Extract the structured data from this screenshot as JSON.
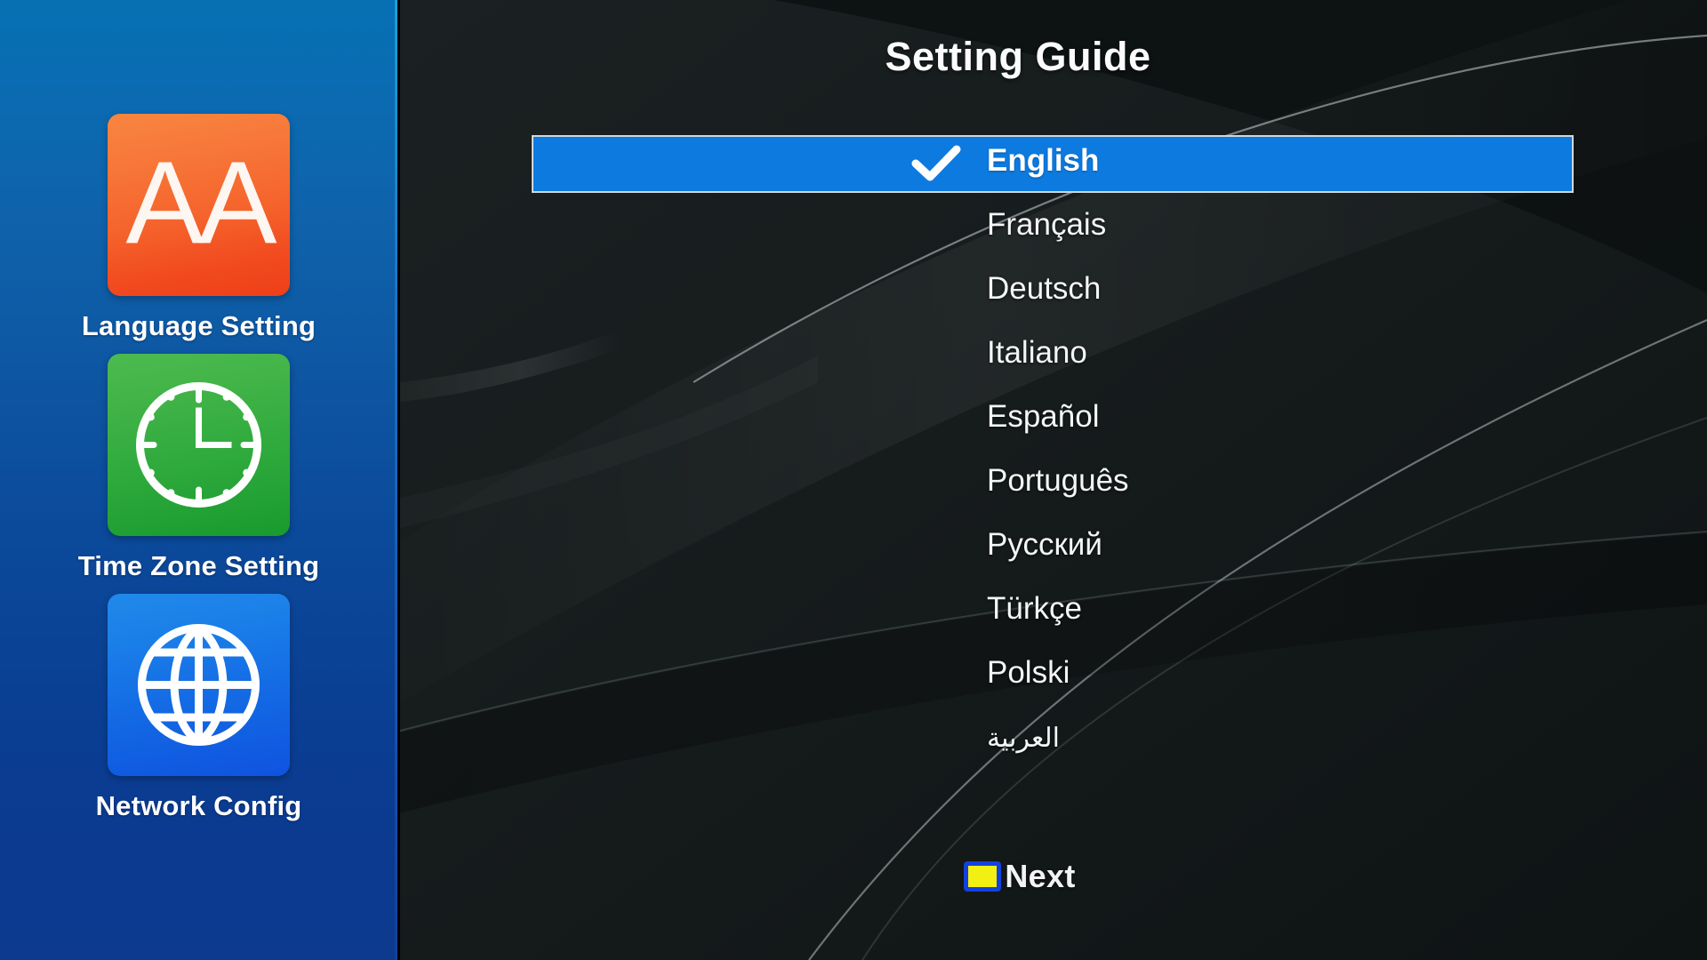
{
  "sidebar": {
    "items": [
      {
        "label": "Language Setting",
        "icon": "text-size-aa-icon",
        "icon_glyph": "AA",
        "color": "#f5642c"
      },
      {
        "label": "Time Zone Setting",
        "icon": "clock-icon",
        "color": "#2ea93c"
      },
      {
        "label": "Network Config",
        "icon": "globe-icon",
        "color": "#1369e4"
      }
    ]
  },
  "main": {
    "title": "Setting Guide",
    "languages": [
      {
        "name": "English",
        "selected": true,
        "rtl": false
      },
      {
        "name": "Français",
        "selected": false,
        "rtl": false
      },
      {
        "name": "Deutsch",
        "selected": false,
        "rtl": false
      },
      {
        "name": "Italiano",
        "selected": false,
        "rtl": false
      },
      {
        "name": "Español",
        "selected": false,
        "rtl": false
      },
      {
        "name": "Português",
        "selected": false,
        "rtl": false
      },
      {
        "name": "Русский",
        "selected": false,
        "rtl": false
      },
      {
        "name": "Türkçe",
        "selected": false,
        "rtl": false
      },
      {
        "name": "Polski",
        "selected": false,
        "rtl": false
      },
      {
        "name": "العربية",
        "selected": false,
        "rtl": true
      }
    ],
    "selected_language": "English",
    "check_icon": "check-mark-icon"
  },
  "footer": {
    "next_label": "Next",
    "key_color": "#f2ef12",
    "key_icon": "yellow-color-key-icon"
  },
  "colors": {
    "highlight_blue": "#0d7ae0",
    "sidebar_blue_top": "#0670b3",
    "sidebar_blue_bottom": "#0d3a8f",
    "panel_background": "#181d1e",
    "text_white": "#f4f6f6"
  }
}
